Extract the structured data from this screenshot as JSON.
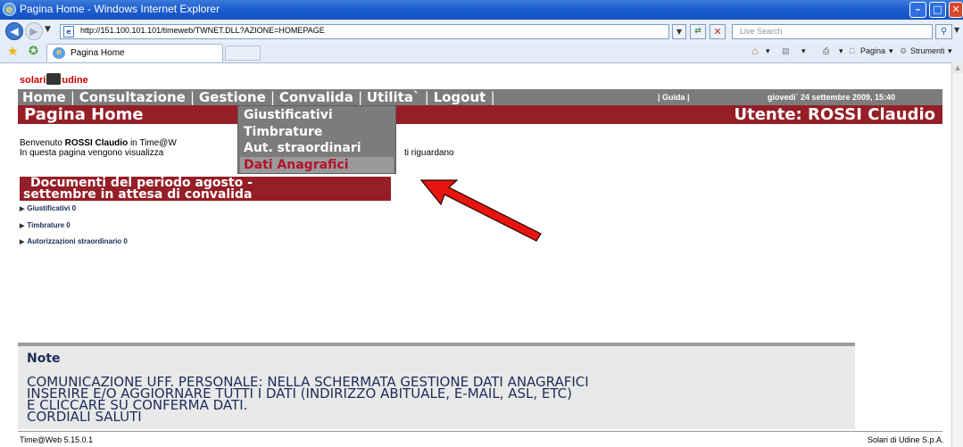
{
  "window": {
    "title": "Pagina Home - Windows Internet Explorer",
    "min": "–",
    "max": "□",
    "close": "✕"
  },
  "address": {
    "url": "http://151.100.101.101/timeweb/TWNET.DLL?AZIONE=HOMEPAGE",
    "search_placeholder": "Live Search"
  },
  "tabs": {
    "active_label": "Pagina Home"
  },
  "toolbar": {
    "pagina": "Pagina",
    "strumenti": "Strumenti"
  },
  "site": {
    "logo_left": "solari",
    "logo_right": "udine",
    "menu": [
      "Home",
      "Consultazione",
      "Gestione",
      "Convalida",
      "Utilita`",
      "Logout"
    ],
    "guida": "| Guida |",
    "date": "giovedi` 24 settembre 2009, 15:40",
    "page_title": "Pagina Home",
    "user": "Utente: ROSSI Claudio"
  },
  "welcome": {
    "prefix": "Benvenuto ",
    "name": "ROSSI Claudio",
    "suffix": " in Time@W",
    "line2": "In questa pagina vengono visualizza",
    "line2_tail": "ti riguardano"
  },
  "dropdown": {
    "items": [
      "Giustificativi",
      "Timbrature",
      "Aut. straordinari",
      "Dati Anagrafici"
    ]
  },
  "documents": {
    "title_line1": "Documenti del periodo agosto -",
    "title_line2": "settembre in attesa di convalida",
    "links": [
      "Giustificativi 0",
      "Timbrature 0",
      "Autorizzazioni straordinario 0"
    ]
  },
  "note": {
    "title": "Note",
    "body": "COMUNICAZIONE UFF. PERSONALE: NELLA SCHERMATA GESTIONE DATI ANAGRAFICI\nINSERIRE E/O AGGIORNARE TUTTI I DATI (INDIRIZZO ABITUALE, E-MAIL, ASL, ETC)\nE CLICCARE SU CONFERMA DATI.\nCORDIALI SALUTI"
  },
  "footer": {
    "version": "Time@Web 5.15.0.1",
    "company": "Solari di Udine S.p.A."
  },
  "colors": {
    "menu_bg": "#7c7c7c",
    "header_bg": "#951e27",
    "highlight_text": "#b3122b",
    "arrow": "#e8140f"
  }
}
